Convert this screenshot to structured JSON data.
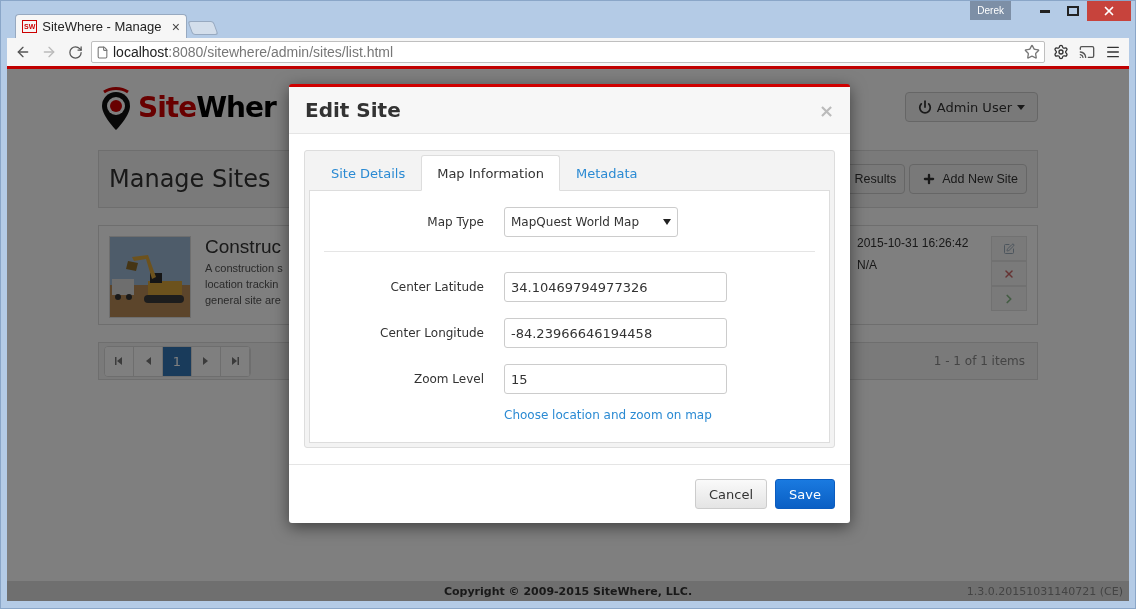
{
  "browser": {
    "tab": {
      "favicon": "SW",
      "title": "SiteWhere - Manage",
      "close": "×"
    },
    "profile": "Derek",
    "url_host": "localhost",
    "url_rest": ":8080/sitewhere/admin/sites/list.html"
  },
  "page": {
    "logo": {
      "first": "Site",
      "second": "Wher"
    },
    "user_button": "Admin User",
    "title": "Manage Sites",
    "header_buttons": [
      {
        "label": "Results",
        "kind": "plain"
      },
      {
        "label": "Add New Site",
        "kind": "add"
      }
    ],
    "site": {
      "image": {
        "kind": "picture"
      },
      "name": "Construc",
      "description_lines": [
        "A construction s",
        "location trackin",
        "general site are"
      ],
      "created": "2015-10-31 16:26:42",
      "updated": "N/A"
    },
    "pagination": {
      "pages": [
        {
          "label": "1",
          "selected": true
        }
      ],
      "summary": "1 - 1 of 1 items"
    },
    "footer": {
      "copyright": "Copyright © 2009-2015 SiteWhere, LLC.",
      "version": "1.3.0.20151031140721 (CE)"
    }
  },
  "dialog": {
    "title": "Edit Site",
    "close": "×",
    "tabs": [
      {
        "label": "Site Details",
        "selected": false
      },
      {
        "label": "Map Information",
        "selected": true
      },
      {
        "label": "Metadata",
        "selected": false
      }
    ],
    "fields": [
      {
        "kind": "select",
        "label": "Map Type",
        "value": "MapQuest World Map"
      },
      {
        "kind": "input",
        "label": "Center Latitude",
        "value": "34.10469794977326"
      },
      {
        "kind": "input",
        "label": "Center Longitude",
        "value": "-84.23966646194458"
      },
      {
        "kind": "input",
        "label": "Zoom Level",
        "value": "15"
      }
    ],
    "link": "Choose location and zoom on map",
    "buttons": [
      {
        "label": "Cancel",
        "kind": "default"
      },
      {
        "label": "Save",
        "kind": "primary"
      }
    ]
  }
}
